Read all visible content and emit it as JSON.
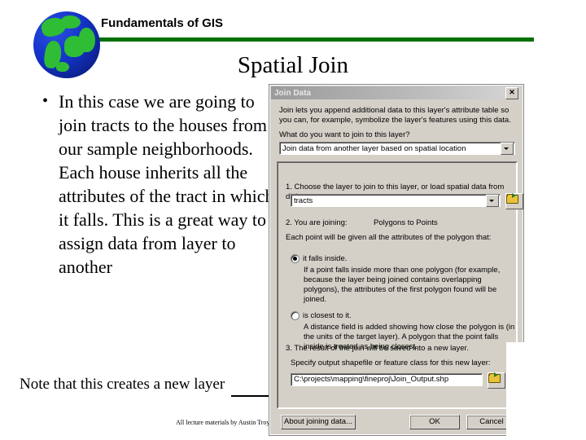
{
  "slide": {
    "header_title": "Fundamentals of GIS",
    "title": "Spatial Join",
    "bullets": [
      "In this case we are going to join tracts to the houses from our sample neighborhoods. Each house inherits all the attributes of the tract in which it falls. This is a great way to assign data from layer to another"
    ],
    "note": "Note that this creates a new layer",
    "footer_credit": "All lecture materials by Austin Troy",
    "accent_color": "#007000",
    "logo_icon": "globe-icon"
  },
  "dialog": {
    "title": "Join Data",
    "close_label": "✕",
    "intro": "Join lets you append additional data to this layer's attribute table so you can, for example, symbolize the layer's features using this data.",
    "question": "What do you want to join to this layer?",
    "join_type_value": "Join data from another layer based on spatial location",
    "step1_label": "1.  Choose the layer to join to this layer, or load spatial data from disk:",
    "step1_value": "tracts",
    "step2_label": "2.  You are joining:",
    "step2_value": "Polygons to Points",
    "step2_desc": "Each point will be given all the attributes of the polygon that:",
    "radio_inside_label": "it falls inside.",
    "radio_inside_desc": "If a point falls inside more than one polygon (for example, because the layer being joined contains overlapping polygons), the attributes of the first polygon found will be joined.",
    "radio_closest_label": "is closest to it.",
    "radio_closest_desc": "A distance field is added showing how close the polygon is (in the units of the target layer). A polygon that the point falls inside is treated as being closest.",
    "step3_label": "3.  The result of the join will be saved into a new layer.",
    "step3_sub": "Specify output shapefile or feature class for this new layer:",
    "output_path": "C:\\projects\\mapping\\fineproj\\Join_Output.shp",
    "browse_icon": "folder-open-icon",
    "dropdown_icon": "chevron-down-icon",
    "about_button": "About joining data...",
    "ok_button": "OK",
    "cancel_button": "Cancel"
  }
}
